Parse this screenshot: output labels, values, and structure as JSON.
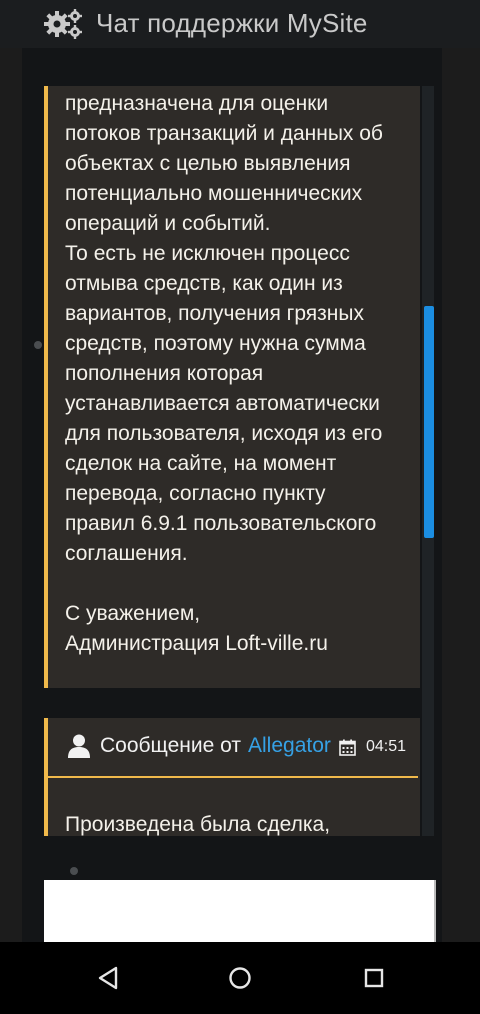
{
  "header": {
    "icon": "gears-icon",
    "title": "Чат поддержки MySite"
  },
  "messages": [
    {
      "text": "предназначена для оценки\nпотоков транзакций и данных об\nобъектах с целью выявления\nпотенциально мошеннических\nопераций и событий.\nТо есть не исключен процесс\nотмыва средств, как один из\nвариантов, получения грязных\nсредств, поэтому нужна сумма\nпополнения которая\nустанавливается автоматически\nдля пользователя, исходя из его\nсделок на сайте, на момент\nперевода, согласно пункту\nправил 6.9.1 пользовательского\nсоглашения.\n\nС уважением,\nАдминистрация Loft-ville.ru"
    },
    {
      "header_prefix": "Сообщение от",
      "author": "Allegator",
      "time": "04:51",
      "text": "Произведена была сделка,"
    }
  ],
  "colors": {
    "accent": "#f0b94b",
    "author_link": "#36a1e5",
    "scrollbar": "#1b8ee2",
    "bubble": "#2e2b28"
  },
  "navbar": {
    "back": "back-icon",
    "home": "home-icon",
    "recents": "recents-icon"
  }
}
